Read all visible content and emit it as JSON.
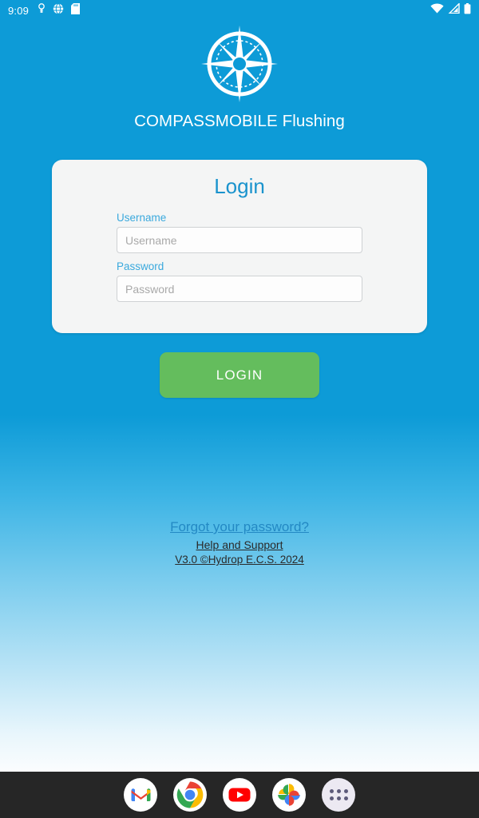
{
  "status_bar": {
    "clock": "9:09",
    "left_icons": [
      "vpn-key-icon",
      "globe-icon",
      "sd-card-icon"
    ],
    "right_icons": [
      "wifi-icon",
      "cellular-signal-icon",
      "battery-icon"
    ]
  },
  "header": {
    "logo_icon": "compass-rose-icon",
    "app_title": "COMPASSMOBILE Flushing"
  },
  "login_card": {
    "title": "Login",
    "username": {
      "label": "Username",
      "placeholder": "Username",
      "value": ""
    },
    "password": {
      "label": "Password",
      "placeholder": "Password",
      "value": ""
    }
  },
  "actions": {
    "login_label": "LOGIN"
  },
  "footer": {
    "forgot_password": "Forgot your password?",
    "help_support": "Help and Support",
    "version": "V3.0 ©Hydrop E.C.S. 2024"
  },
  "dock": {
    "items": [
      {
        "name": "gmail-icon"
      },
      {
        "name": "chrome-icon"
      },
      {
        "name": "youtube-icon"
      },
      {
        "name": "google-photos-icon"
      },
      {
        "name": "app-drawer-icon"
      }
    ]
  },
  "colors": {
    "brand_blue": "#0d9bd7",
    "card_bg": "#f4f5f5",
    "title_blue": "#1a93cd",
    "label_blue": "#3aa9dd",
    "login_green": "#64bd5d",
    "link_blue": "#2389c4",
    "dock_bg": "#262626"
  }
}
